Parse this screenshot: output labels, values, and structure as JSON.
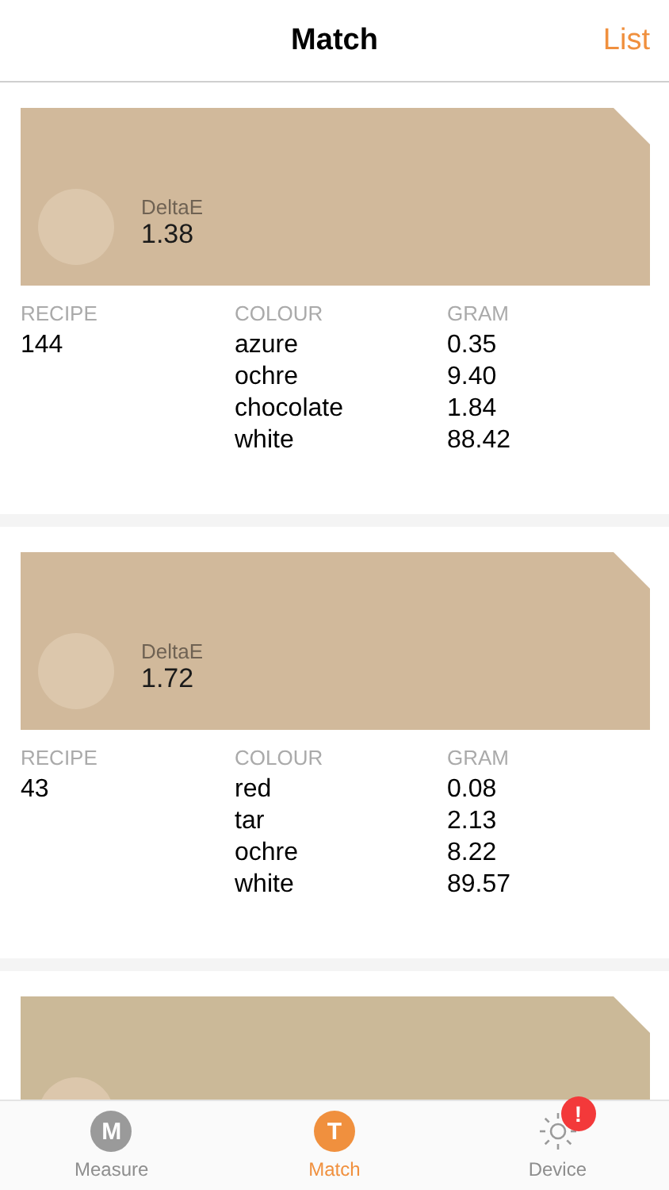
{
  "header": {
    "title": "Match",
    "action": "List"
  },
  "matches": [
    {
      "color": "#d1b99b",
      "delta_label": "DeltaE",
      "delta": "1.38",
      "headers": [
        "RECIPE",
        "COLOUR",
        "GRAM"
      ],
      "recipe": "144",
      "colours": [
        {
          "name": "azure",
          "gram": "0.35"
        },
        {
          "name": "ochre",
          "gram": "9.40"
        },
        {
          "name": "chocolate",
          "gram": "1.84"
        },
        {
          "name": "white",
          "gram": "88.42"
        }
      ]
    },
    {
      "color": "#d1b99b",
      "delta_label": "DeltaE",
      "delta": "1.72",
      "headers": [
        "RECIPE",
        "COLOUR",
        "GRAM"
      ],
      "recipe": "43",
      "colours": [
        {
          "name": "red",
          "gram": "0.08"
        },
        {
          "name": "tar",
          "gram": "2.13"
        },
        {
          "name": "ochre",
          "gram": "8.22"
        },
        {
          "name": "white",
          "gram": "89.57"
        }
      ]
    },
    {
      "color": "#cbb998"
    }
  ],
  "tabs": [
    {
      "label": "Measure",
      "letter": "M",
      "kind": "letter",
      "selected": false
    },
    {
      "label": "Match",
      "letter": "T",
      "kind": "letter",
      "selected": true
    },
    {
      "label": "Device",
      "kind": "sun",
      "selected": false,
      "badge": "!"
    }
  ]
}
